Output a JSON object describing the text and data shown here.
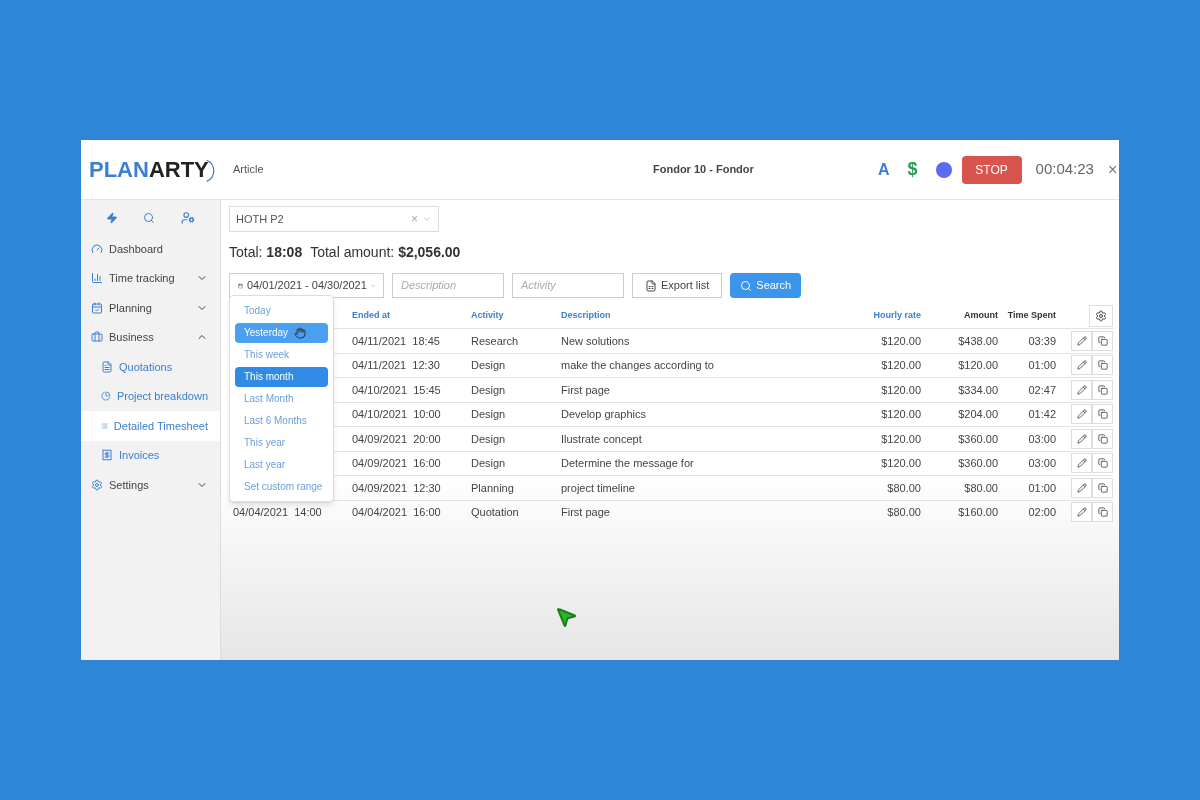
{
  "header": {
    "logo_left": "PLAN",
    "logo_right": "ARTY",
    "section": "Article",
    "project": "Fondor 10 - Fondor",
    "letter_badge": "A",
    "currency_badge": "$",
    "stop_button": "STOP",
    "timer": "00:04:23",
    "close": "×"
  },
  "sidebar": {
    "items": [
      {
        "label": "Dashboard",
        "selected": false
      },
      {
        "label": "Time tracking",
        "expanded": false,
        "selected": false
      },
      {
        "label": "Planning",
        "expanded": false,
        "selected": false
      },
      {
        "label": "Business",
        "expanded": true,
        "selected": false,
        "children": [
          {
            "label": "Quotations",
            "selected": false
          },
          {
            "label": "Project breakdown",
            "selected": false
          },
          {
            "label": "Detailed Timesheet",
            "selected": true
          },
          {
            "label": "Invoices",
            "selected": false
          }
        ]
      },
      {
        "label": "Settings",
        "expanded": false,
        "selected": false
      }
    ]
  },
  "project_select": {
    "value": "HOTH P2",
    "clear": "×"
  },
  "totals": {
    "total_label": "Total:",
    "total": "18:08",
    "amount_label": "Total amount:",
    "amount": "$2,056.00"
  },
  "filters": {
    "date_range": "04/01/2021 - 04/30/2021",
    "description_placeholder": "Description",
    "activity_placeholder": "Activity",
    "export_button": "Export list",
    "search_button": "Search"
  },
  "date_menu": [
    {
      "label": "Today",
      "selected": false,
      "hovered": false
    },
    {
      "label": "Yesterday",
      "selected": false,
      "hovered": true
    },
    {
      "label": "This week",
      "selected": false,
      "hovered": false
    },
    {
      "label": "This month",
      "selected": true,
      "hovered": false
    },
    {
      "label": "Last Month",
      "selected": false,
      "hovered": false
    },
    {
      "label": "Last 6 Months",
      "selected": false,
      "hovered": false
    },
    {
      "label": "This year",
      "selected": false,
      "hovered": false
    },
    {
      "label": "Last year",
      "selected": false,
      "hovered": false
    },
    {
      "label": "Set custom range",
      "selected": false,
      "hovered": false
    }
  ],
  "table": {
    "columns": [
      {
        "label": "Ended at",
        "sortable": true
      },
      {
        "label": "Activity",
        "sortable": true
      },
      {
        "label": "Description",
        "sortable": true
      },
      {
        "label": "Hourly rate",
        "sortable": true
      },
      {
        "label": "Amount",
        "sortable": false
      },
      {
        "label": "Time Spent",
        "sortable": false
      }
    ],
    "rows": [
      {
        "ended": "04/11/2021  18:45",
        "activity": "Research",
        "description": "New solutions",
        "rate": "$120.00",
        "amount": "$438.00",
        "time": "03:39"
      },
      {
        "ended": "04/11/2021  12:30",
        "activity": "Design",
        "description": "make the changes according to",
        "rate": "$120.00",
        "amount": "$120.00",
        "time": "01:00"
      },
      {
        "ended": "04/10/2021  15:45",
        "activity": "Design",
        "description": "First page",
        "rate": "$120.00",
        "amount": "$334.00",
        "time": "02:47"
      },
      {
        "ended": "04/10/2021  10:00",
        "activity": "Design",
        "description": "Develop graphics",
        "rate": "$120.00",
        "amount": "$204.00",
        "time": "01:42"
      },
      {
        "ended": "04/09/2021  20:00",
        "activity": "Design",
        "description": "Ilustrate concept",
        "rate": "$120.00",
        "amount": "$360.00",
        "time": "03:00"
      },
      {
        "ended": "04/09/2021  16:00",
        "activity": "Design",
        "description": "Determine the message for",
        "rate": "$120.00",
        "amount": "$360.00",
        "time": "03:00"
      },
      {
        "ended": "04/09/2021  12:30",
        "activity": "Planning",
        "description": "project timeline",
        "rate": "$80.00",
        "amount": "$80.00",
        "time": "01:00"
      },
      {
        "started": "04/04/2021  14:00",
        "ended": "04/04/2021  16:00",
        "activity": "Quotation",
        "description": "First page",
        "rate": "$80.00",
        "amount": "$160.00",
        "time": "02:00"
      }
    ]
  }
}
